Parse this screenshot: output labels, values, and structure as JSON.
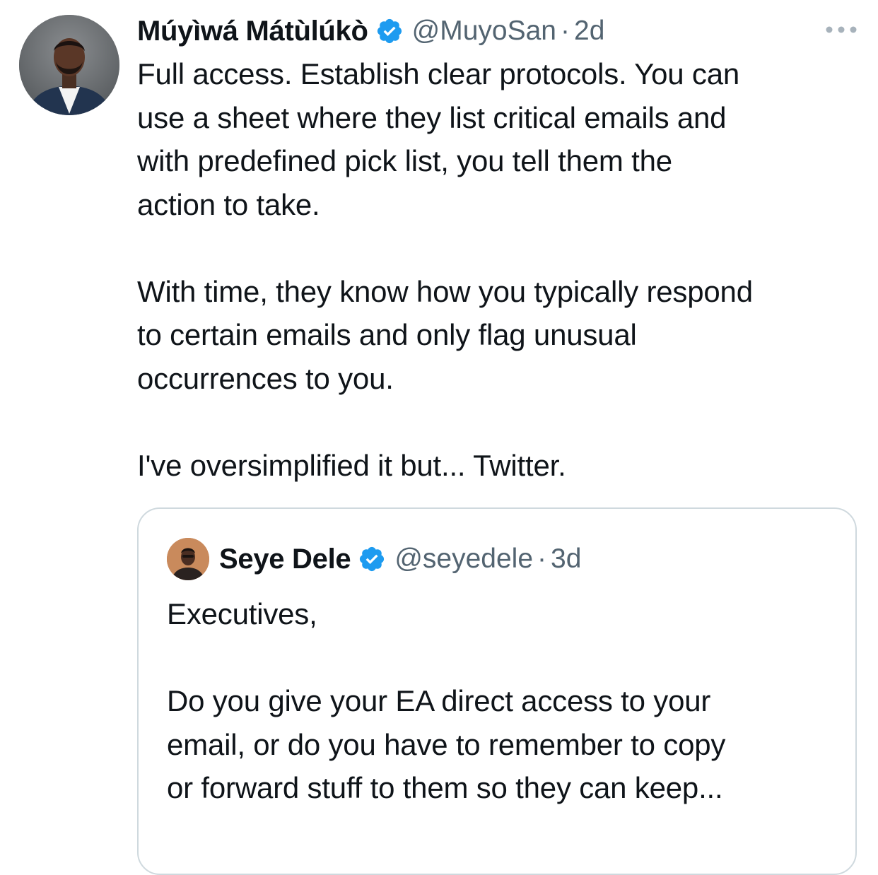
{
  "tweet": {
    "author": {
      "display_name": "Múyìwá Mátùlúkò",
      "handle": "@MuyoSan",
      "separator": "·",
      "time": "2d",
      "verified_icon": "verified-badge-icon",
      "avatar_icon": "avatar"
    },
    "more_icon": "more-options-icon",
    "paragraphs": [
      [
        "Full access. Establish clear protocols. You can",
        "use a sheet where they list critical emails and",
        "with predefined pick list, you tell them the",
        "action to take."
      ],
      [
        "With time, they know how you typically respond",
        "to certain emails and only flag unusual",
        "occurrences to you."
      ],
      [
        "I've oversimplified it but... Twitter."
      ]
    ]
  },
  "quoted_tweet": {
    "author": {
      "display_name": "Seye Dele",
      "handle": "@seyedele",
      "separator": "·",
      "time": "3d",
      "verified_icon": "verified-badge-icon"
    },
    "paragraphs": [
      [
        "Executives,"
      ],
      [
        "Do you give your EA direct access to your",
        "email, or do you have to remember to copy",
        "or forward stuff to them so they can keep..."
      ]
    ]
  },
  "colors": {
    "text": "#0f1419",
    "secondary": "#536471",
    "verified": "#1d9bf0",
    "border": "#cfd9de"
  }
}
